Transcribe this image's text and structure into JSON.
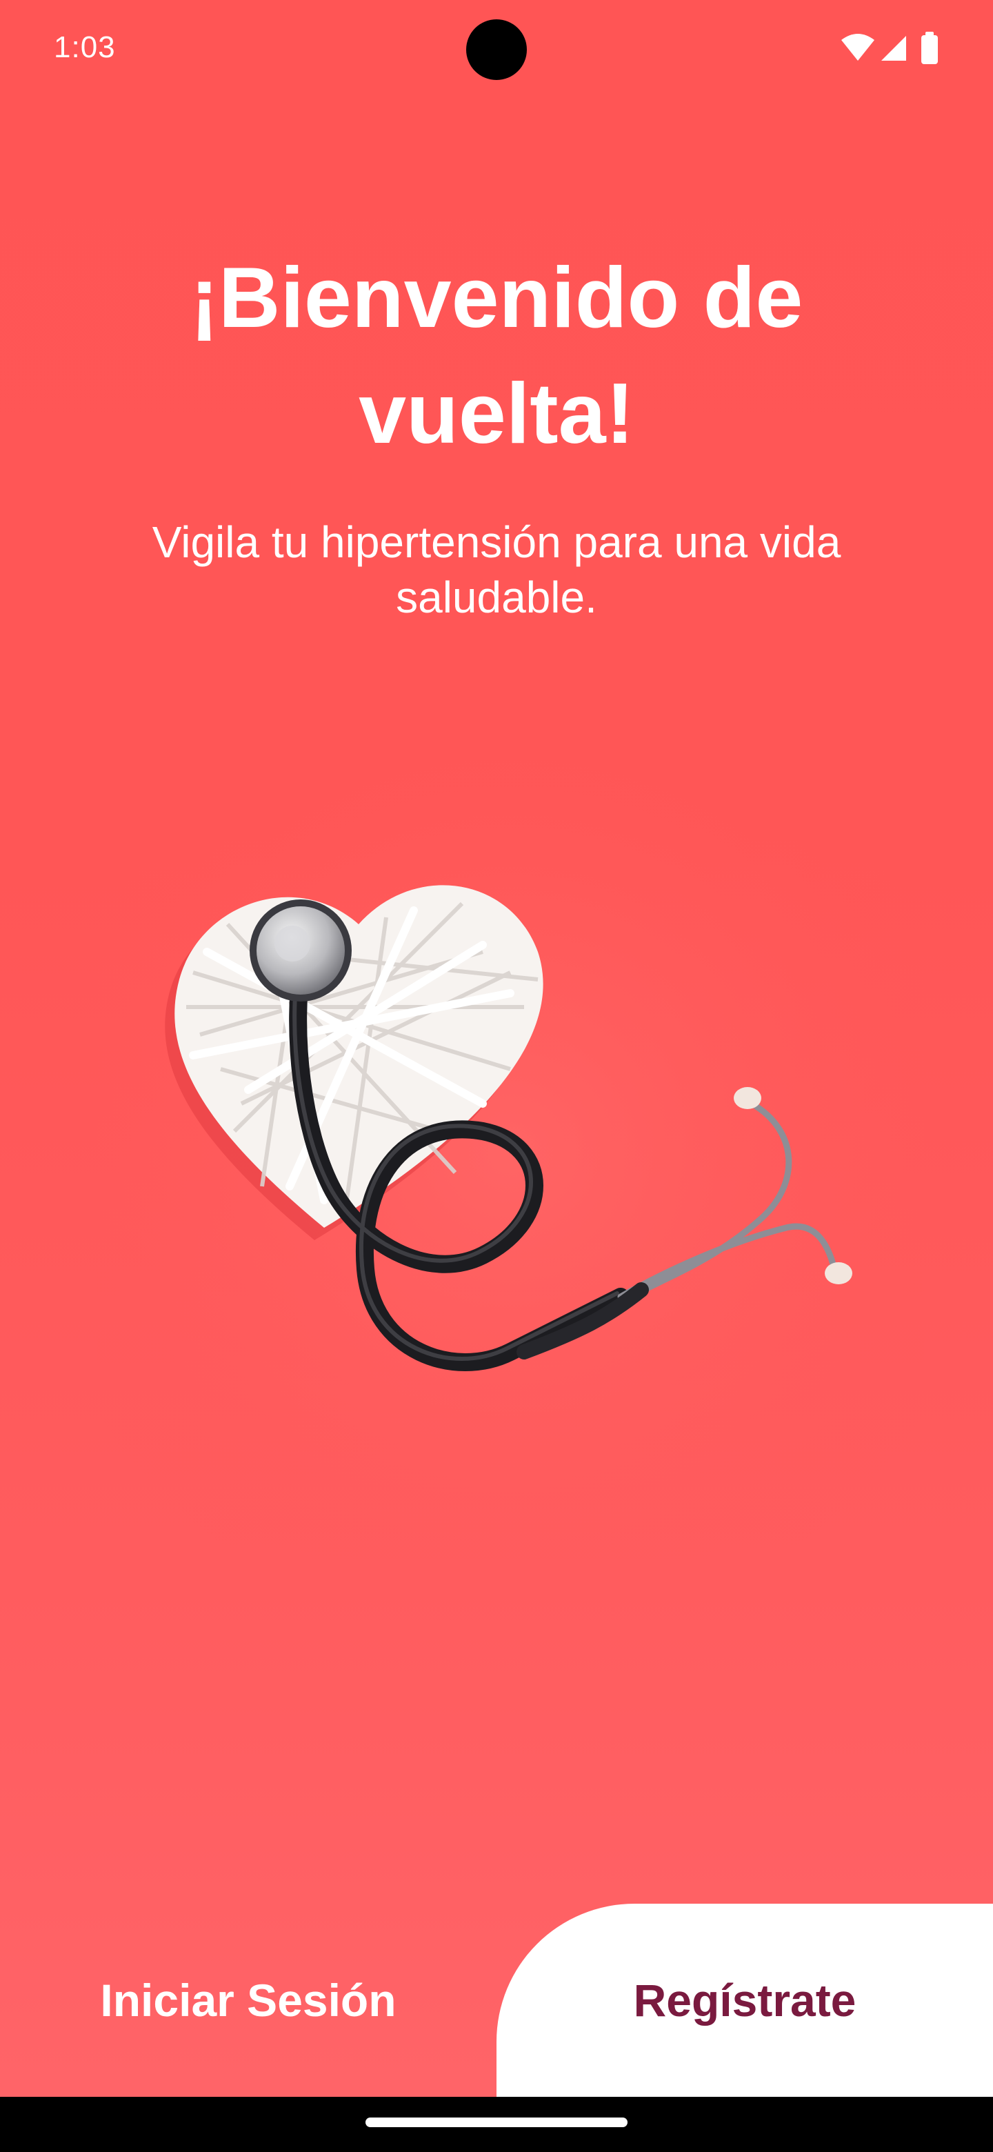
{
  "status_bar": {
    "time": "1:03",
    "icons": [
      "wifi-icon",
      "signal-icon",
      "battery-icon"
    ]
  },
  "welcome": {
    "title": "¡Bienvenido de vuelta!",
    "subtitle": "Vigila tu hipertensión para una vida saludable."
  },
  "hero": {
    "image": "heart-and-stethoscope-illustration"
  },
  "actions": {
    "login_label": "Iniciar Sesión",
    "register_label": "Regístrate"
  },
  "colors": {
    "background": "#FF5A5A",
    "register_text": "#7A1A3F",
    "button_light": "#FFFFFF"
  }
}
